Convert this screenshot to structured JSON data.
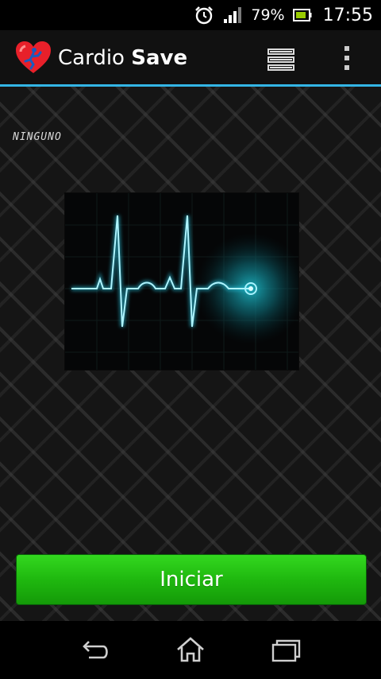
{
  "status_bar": {
    "battery_percent": "79%",
    "time": "17:55",
    "icons": [
      "alarm-clock-icon",
      "signal-icon",
      "battery-icon"
    ]
  },
  "action_bar": {
    "title_regular": "Cardio",
    "title_bold": "Save",
    "app_icon": "heart-runner-icon",
    "accent_color": "#33b5e5",
    "actions": [
      "list-icon",
      "overflow-menu-icon"
    ]
  },
  "main": {
    "mode_label": "NINGUNO",
    "start_button_label": "Iniciar",
    "button_color": "#1fb80f",
    "ecg_color": "#7fe7ff"
  },
  "nav_bar": {
    "buttons": [
      "back-icon",
      "home-icon",
      "recent-apps-icon"
    ]
  }
}
